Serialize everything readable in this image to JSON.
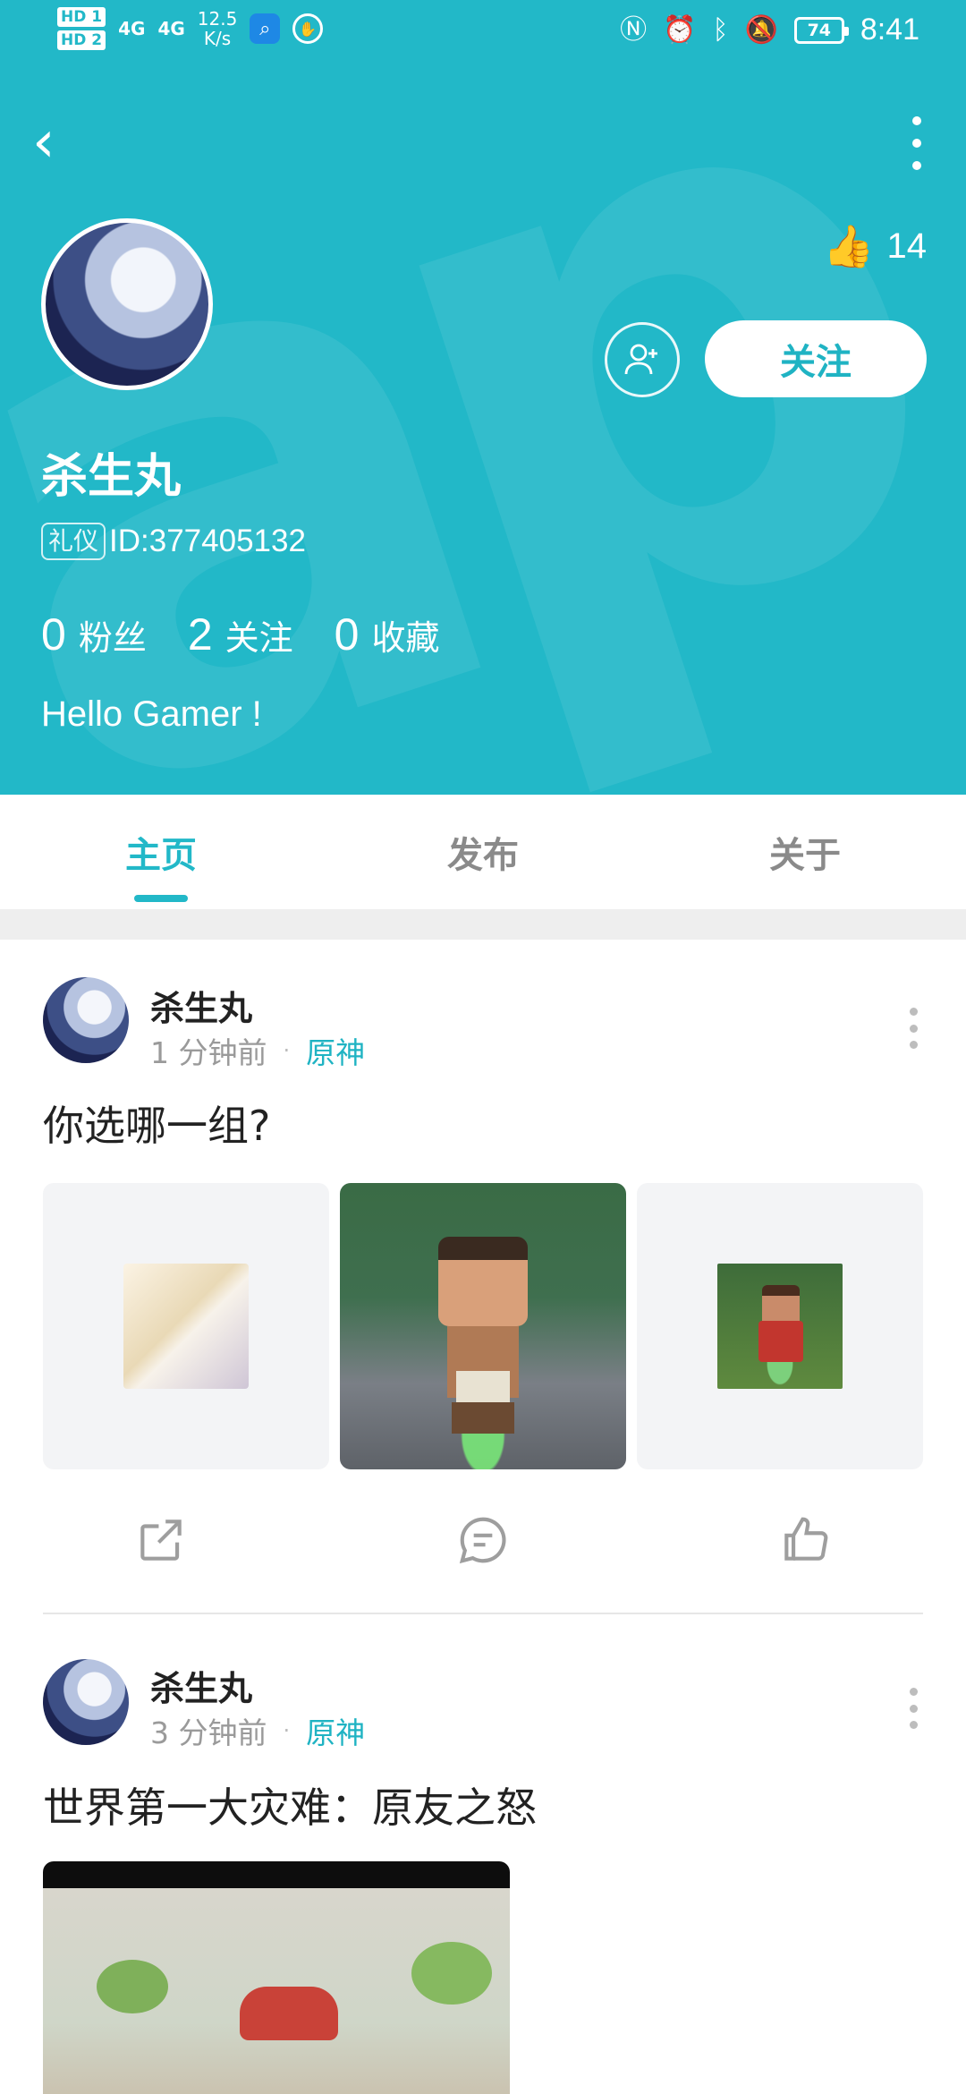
{
  "status_bar": {
    "sim1": "HD 1",
    "sim2": "HD 2",
    "net1": "4G",
    "net2": "4G",
    "speed_value": "12.5",
    "speed_unit": "K/s",
    "battery": "74",
    "time": "8:41"
  },
  "profile": {
    "likes": "14",
    "follow_label": "关注",
    "username": "杀生丸",
    "badge": "礼仪",
    "id_text": "ID:377405132",
    "stats": [
      {
        "count": "0",
        "label": "粉丝"
      },
      {
        "count": "2",
        "label": "关注"
      },
      {
        "count": "0",
        "label": "收藏"
      }
    ],
    "bio": "Hello Gamer !"
  },
  "tabs": [
    {
      "label": "主页",
      "active": true
    },
    {
      "label": "发布",
      "active": false
    },
    {
      "label": "关于",
      "active": false
    }
  ],
  "posts": [
    {
      "author": "杀生丸",
      "time": "1 分钟前",
      "separator": "·",
      "game": "原神",
      "text": "你选哪一组?"
    },
    {
      "author": "杀生丸",
      "time": "3 分钟前",
      "separator": "·",
      "game": "原神",
      "text": "世界第一大灾难：原友之怒"
    }
  ],
  "colors": {
    "accent": "#22b8c8",
    "tab_inactive": "#8a8a8a",
    "meta_gray": "#9a9a9a"
  },
  "icons": [
    "back-arrow-icon",
    "more-vertical-icon",
    "thumbs-up-icon",
    "add-friend-icon",
    "share-icon",
    "comment-icon",
    "like-icon"
  ]
}
